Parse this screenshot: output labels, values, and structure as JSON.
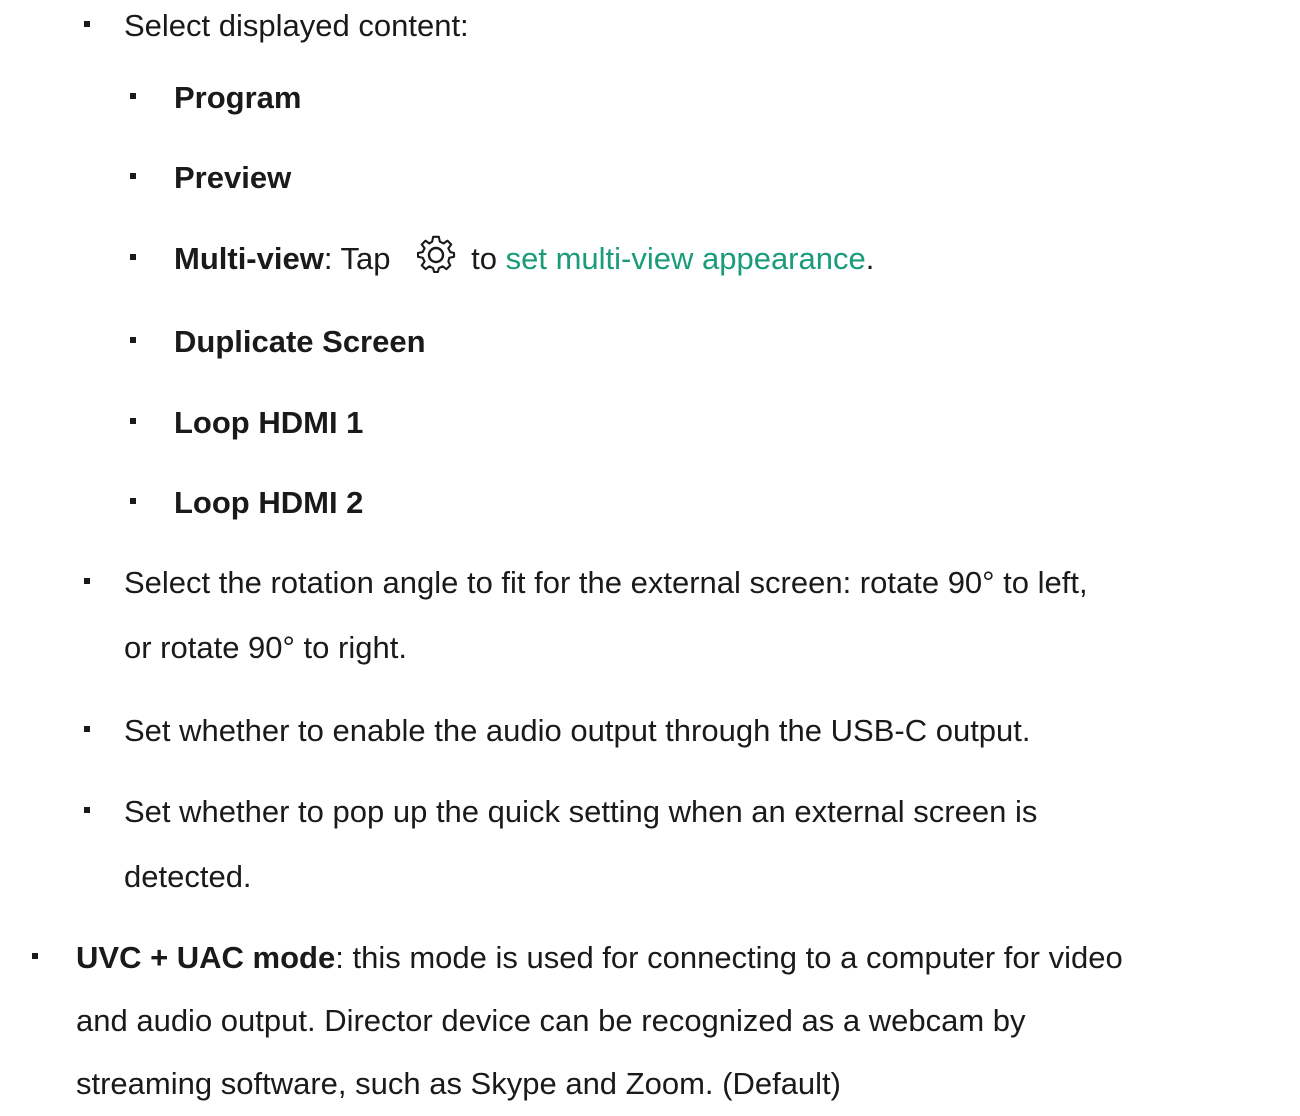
{
  "list": {
    "select_content": "Select displayed content:",
    "content_options": [
      {
        "label": "Program"
      },
      {
        "label": "Preview"
      },
      {
        "label": "Multi-view",
        "sep": ": Tap",
        "after_icon": "to",
        "link": "set multi-view appearance",
        "end": "."
      },
      {
        "label": "Duplicate Screen"
      },
      {
        "label": "Loop HDMI 1"
      },
      {
        "label": "Loop HDMI 2"
      }
    ],
    "rotation_line1": "Select the rotation angle to fit for the external screen: rotate 90° to left,",
    "rotation_line2": "or rotate 90° to right.",
    "audio": "Set whether to enable the audio output through the USB-C output.",
    "popup_line1": "Set whether to pop up the quick setting when an external screen is",
    "popup_line2": "detected.",
    "uvc": {
      "label": "UVC + UAC mode",
      "line1_rest": ": this mode is used for connecting to a computer for video",
      "line2": "and audio output. Director device can be recognized as a webcam by",
      "line3": "streaming software, such as Skype and Zoom. (Default)"
    }
  },
  "icons": {
    "settings": "gear-icon"
  },
  "colors": {
    "text": "#1a1a1a",
    "link": "#1a9c7a"
  }
}
